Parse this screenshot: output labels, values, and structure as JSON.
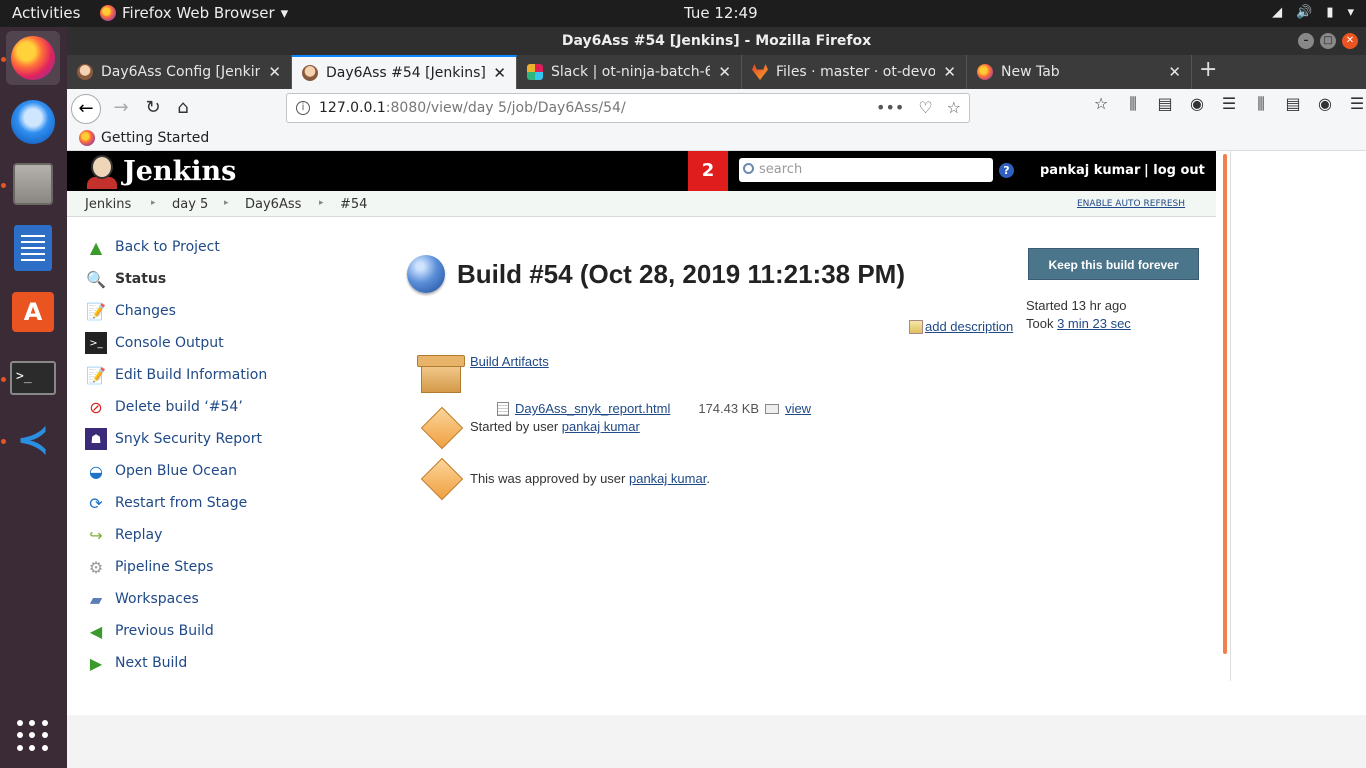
{
  "desktop": {
    "activities": "Activities",
    "app_menu": "Firefox Web Browser",
    "clock": "Tue 12:49"
  },
  "window": {
    "title": "Day6Ass #54 [Jenkins] - Mozilla Firefox"
  },
  "tabs": [
    {
      "label": "Day6Ass Config [Jenkins]",
      "selected": false
    },
    {
      "label": "Day6Ass #54 [Jenkins]",
      "selected": true
    },
    {
      "label": "Slack | ot-ninja-batch-6 | OpsTree",
      "selected": false
    },
    {
      "label": "Files · master · ot-devops",
      "selected": false
    },
    {
      "label": "New Tab",
      "selected": false
    }
  ],
  "url": {
    "host": "127.0.0.1",
    "path": ":8080/view/day 5/job/Day6Ass/54/"
  },
  "bookmarks": {
    "getting_started": "Getting Started"
  },
  "jenkins": {
    "logo_text": "Jenkins",
    "notification_count": "2",
    "search_placeholder": "search",
    "user": "pankaj kumar",
    "logout": "| log out",
    "breadcrumbs": [
      "Jenkins",
      "day 5",
      "Day6Ass",
      "#54"
    ],
    "enable_auto_refresh": "ENABLE AUTO REFRESH",
    "tasks": [
      {
        "label": "Back to Project",
        "icon": "up-arrow-icon"
      },
      {
        "label": "Status",
        "icon": "magnifier-icon"
      },
      {
        "label": "Changes",
        "icon": "notepad-icon"
      },
      {
        "label": "Console Output",
        "icon": "terminal-icon"
      },
      {
        "label": "Edit Build Information",
        "icon": "notepad-icon"
      },
      {
        "label": "Delete build ‘#54’",
        "icon": "no-entry-icon"
      },
      {
        "label": "Snyk Security Report",
        "icon": "snyk-icon"
      },
      {
        "label": "Open Blue Ocean",
        "icon": "blue-ocean-icon"
      },
      {
        "label": "Restart from Stage",
        "icon": "restart-icon"
      },
      {
        "label": "Replay",
        "icon": "replay-arrow-icon"
      },
      {
        "label": "Pipeline Steps",
        "icon": "gear-icon"
      },
      {
        "label": "Workspaces",
        "icon": "folder-icon"
      },
      {
        "label": "Previous Build",
        "icon": "left-arrow-icon"
      },
      {
        "label": "Next Build",
        "icon": "right-arrow-icon"
      }
    ],
    "build_title": "Build #54 (Oct 28, 2019 11:21:38 PM)",
    "keep_forever": "Keep this build forever",
    "started_ago": "Started 13 hr ago",
    "took_prefix": "Took",
    "took_duration": "3 min 23 sec",
    "add_description": "add description",
    "build_artifacts": "Build Artifacts",
    "artifact_name": "Day6Ass_snyk_report.html",
    "artifact_size": "174.43 KB",
    "artifact_view": "view",
    "started_by_text": "Started by user",
    "started_by_user": "pankaj kumar",
    "approved_text": "This was approved by user",
    "approved_user": "pankaj kumar",
    "approved_suffix": "."
  }
}
